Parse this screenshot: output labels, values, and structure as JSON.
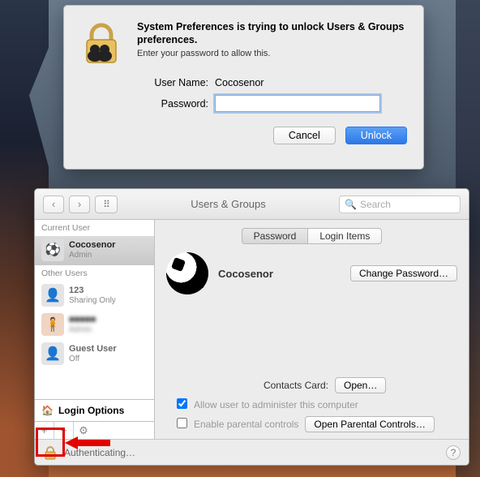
{
  "auth_dialog": {
    "title": "System Preferences is trying to unlock Users & Groups preferences.",
    "subtitle": "Enter your password to allow this.",
    "username_label": "User Name:",
    "username_value": "Cocosenor",
    "password_label": "Password:",
    "password_value": "",
    "cancel_label": "Cancel",
    "unlock_label": "Unlock"
  },
  "window": {
    "title": "Users & Groups",
    "search_placeholder": "Search",
    "sidebar": {
      "current_user_header": "Current User",
      "other_users_header": "Other Users",
      "users": [
        {
          "name": "Cocosenor",
          "role": "Admin",
          "selected": true
        },
        {
          "name": "123",
          "role": "Sharing Only",
          "selected": false
        },
        {
          "name": "■■■■■",
          "role": "Admin",
          "selected": false,
          "blurred": true
        },
        {
          "name": "Guest User",
          "role": "Off",
          "selected": false
        }
      ],
      "login_options_label": "Login Options"
    },
    "tabs": {
      "password": "Password",
      "login_items": "Login Items"
    },
    "profile_name": "Cocosenor",
    "change_password_label": "Change Password…",
    "contacts_card_label": "Contacts Card:",
    "open_label": "Open…",
    "admin_checkbox_label": "Allow user to administer this computer",
    "parental_checkbox_label": "Enable parental controls",
    "parental_button_label": "Open Parental Controls…",
    "footer_status": "Authenticating…"
  }
}
